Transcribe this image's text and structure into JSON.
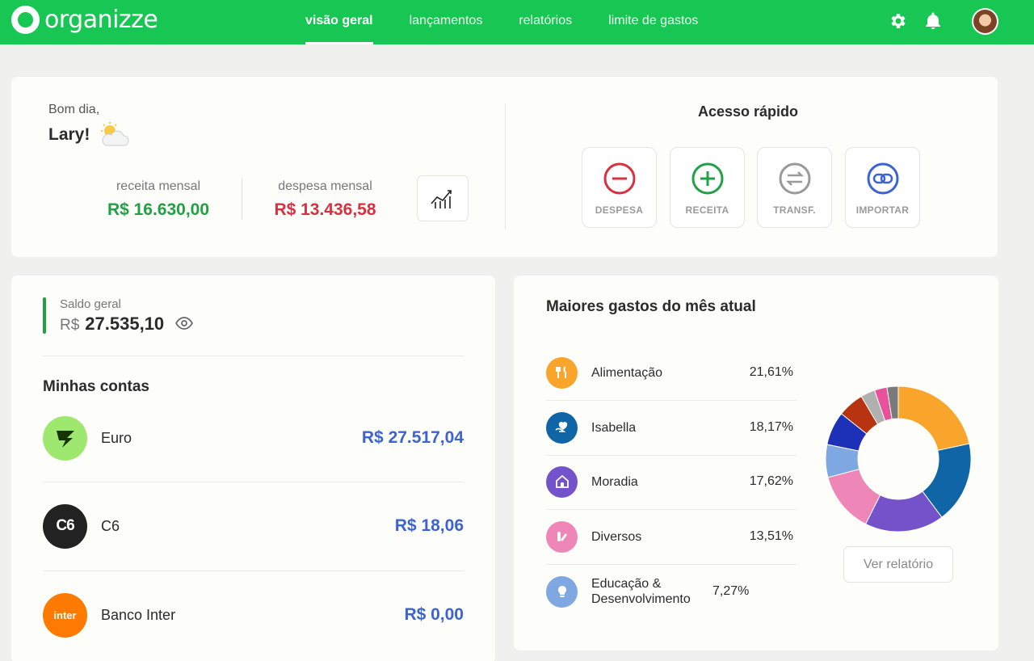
{
  "app": {
    "logo_text": "organizze"
  },
  "nav": {
    "items": [
      "visão geral",
      "lançamentos",
      "relatórios",
      "limite de gastos"
    ],
    "active_index": 0
  },
  "header_icons": [
    "gear-icon",
    "bell-icon",
    "user-avatar"
  ],
  "greeting": {
    "salutation": "Bom dia,",
    "name": "Lary!",
    "weather_icon": "partly-cloudy-icon"
  },
  "summary": {
    "income_label": "receita mensal",
    "income_value": "R$ 16.630,00",
    "expense_label": "despesa mensal",
    "expense_value": "R$ 13.436,58"
  },
  "quick_access": {
    "title": "Acesso rápido",
    "buttons": [
      {
        "label": "DESPESA",
        "icon": "minus-circle-icon",
        "color": "#d93040"
      },
      {
        "label": "RECEITA",
        "icon": "plus-circle-icon",
        "color": "#21a045"
      },
      {
        "label": "TRANSF.",
        "icon": "transfer-icon",
        "color": "#9a9a9a"
      },
      {
        "label": "IMPORTAR",
        "icon": "link-icon",
        "color": "#3d63d1"
      }
    ]
  },
  "balance": {
    "label": "Saldo geral",
    "currency": "R$",
    "value": "27.535,10"
  },
  "accounts": {
    "title": "Minhas contas",
    "items": [
      {
        "name": "Euro",
        "balance": "R$ 27.517,04",
        "logo": "wise-logo",
        "logo_color": "#9fe870"
      },
      {
        "name": "C6",
        "balance": "R$ 18,06",
        "logo_text": "C6",
        "logo_color": "#222222"
      },
      {
        "name": "Banco Inter",
        "balance": "R$ 0,00",
        "logo_text": "inter",
        "logo_color": "#ff7a00"
      }
    ]
  },
  "top_expenses": {
    "title": "Maiores gastos do mês atual",
    "categories": [
      {
        "name": "Alimentação",
        "percent": "21,61%",
        "color": "#f9a52b",
        "icon": "fork-knife-icon"
      },
      {
        "name": "Isabella",
        "percent": "18,17%",
        "color": "#0f65a5",
        "icon": "heart-hand-icon"
      },
      {
        "name": "Moradia",
        "percent": "17,62%",
        "color": "#7452c9",
        "icon": "house-icon"
      },
      {
        "name": "Diversos",
        "percent": "13,51%",
        "color": "#ee87b8",
        "icon": "misc-icon"
      },
      {
        "name": "Educação & Desenvolvimento",
        "percent": "7,27%",
        "color": "#7fa8e3",
        "icon": "lightbulb-icon"
      }
    ],
    "report_button": "Ver relatório"
  },
  "chart_data": {
    "type": "pie",
    "categories": [
      "Alimentação",
      "Isabella",
      "Moradia",
      "Diversos",
      "Educação & Desenvolvimento",
      "",
      "",
      "",
      "",
      ""
    ],
    "values": [
      21.61,
      18.17,
      17.62,
      13.51,
      7.27,
      7.5,
      5.8,
      3.2,
      2.8,
      2.5
    ],
    "colors": [
      "#f9a52b",
      "#0f65a5",
      "#7452c9",
      "#ee87b8",
      "#7fa8e3",
      "#1c31b8",
      "#b8330f",
      "#b0b0b0",
      "#e9519a",
      "#7a7a7a"
    ]
  }
}
